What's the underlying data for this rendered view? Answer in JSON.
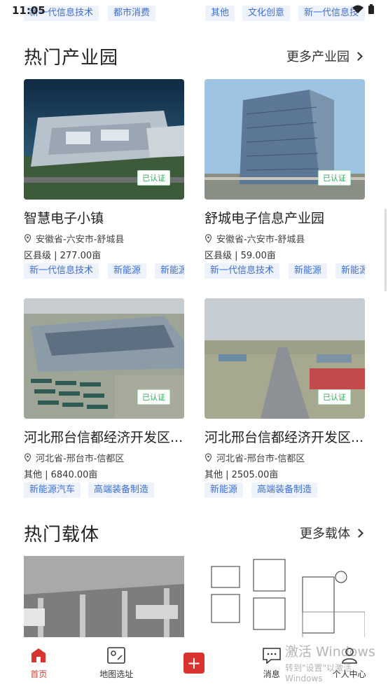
{
  "status_bar": {
    "time": "11:05"
  },
  "top_tags_left": [
    "新一代信息技术",
    "都市消费"
  ],
  "top_tags_right": [
    "其他",
    "文化创意",
    "新一代信息技"
  ],
  "hot_parks": {
    "title": "热门产业园",
    "more_label": "更多产业园",
    "cards": [
      {
        "name": "智慧电子小镇",
        "location": "安徽省-六安市-舒城县",
        "meta": "区县级 | 277.00亩",
        "badge": "已认证",
        "tags": [
          "新一代信息技术",
          "新能源",
          "新能源"
        ]
      },
      {
        "name": "舒城电子信息产业园",
        "location": "安徽省-六安市-舒城县",
        "meta": "区县级 | 59.00亩",
        "badge": "已认证",
        "tags": [
          "新一代信息技术",
          "新能源",
          "新能源"
        ]
      },
      {
        "name": "河北邢台信都经济开发区...",
        "location": "河北省-邢台市-信都区",
        "meta": "其他 | 6840.00亩",
        "badge": "已认证",
        "tags": [
          "新能源汽车",
          "高端装备制造"
        ]
      },
      {
        "name": "河北邢台信都经济开发区...",
        "location": "河北省-邢台市-信都区",
        "meta": "其他 | 2505.00亩",
        "badge": "已认证",
        "tags": [
          "新能源",
          "高端装备制造"
        ]
      }
    ]
  },
  "hot_carriers": {
    "title": "热门载体",
    "more_label": "更多载体"
  },
  "bottom_nav": {
    "home": "首页",
    "map": "地图选址",
    "messages": "消息",
    "profile": "个人中心"
  },
  "watermark": {
    "line1": "激活 Windows",
    "line2": "转到\"设置\"以激活 Windows"
  },
  "colors": {
    "accent": "#d9332f",
    "tag_text": "#3e6fd8",
    "tag_bg": "#eef2fb",
    "badge": "#2fae5a"
  }
}
